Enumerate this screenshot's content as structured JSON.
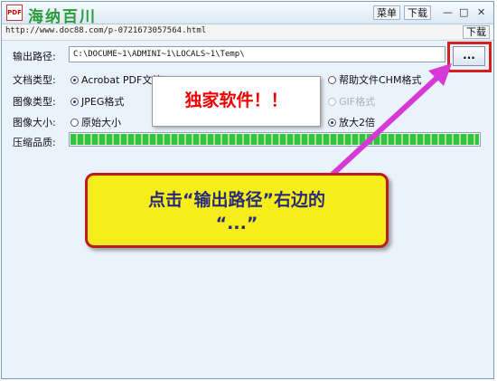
{
  "app": {
    "title": "海纳百川",
    "menu_label": "菜单",
    "download_label": "下载",
    "minimize": "—",
    "restore": "□",
    "close": "✕"
  },
  "urlbar": {
    "url": "http://www.doc88.com/p-0721673057564.html",
    "download_label": "下载"
  },
  "form": {
    "output_path_label": "输出路径:",
    "output_path_value": "C:\\DOCUME~1\\ADMINI~1\\LOCALS~1\\Temp\\",
    "browse_label": "...",
    "doc_type_label": "文档类型:",
    "doc_type_options": [
      "Acrobat PDF文档",
      "帮助文件CHM格式"
    ],
    "doc_type_selected": "Acrobat PDF文档",
    "image_type_label": "图像类型:",
    "image_type_options": [
      "JPEG格式",
      "GIF格式"
    ],
    "image_type_selected": "JPEG格式",
    "image_size_label": "图像大小:",
    "image_size_options": [
      "原始大小",
      "放大2倍"
    ],
    "image_size_selected": "放大2倍",
    "quality_label": "压缩品质:",
    "quality_fraction": 1.0
  },
  "overlay": {
    "promo_text": "独家软件！！",
    "callout_line1": "点击“输出路径”右边的",
    "callout_line2": "“...”"
  },
  "colors": {
    "title_green": "#2a9d3a",
    "highlight_red": "#d62020",
    "callout_yellow": "#f6ee1a",
    "arrow_magenta": "#d63ad6"
  }
}
